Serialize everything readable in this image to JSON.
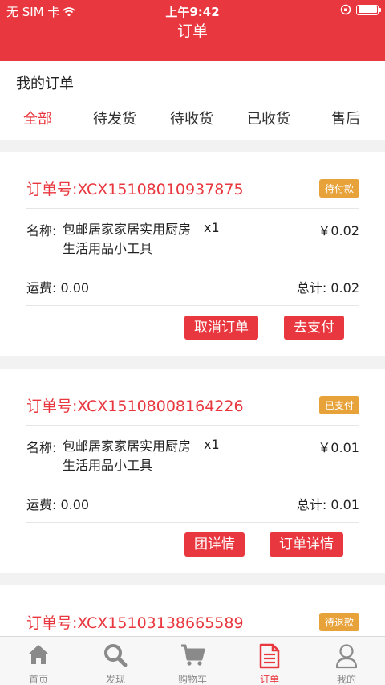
{
  "status_bar": {
    "carrier": "无 SIM 卡",
    "time": "上午9:42"
  },
  "nav": {
    "title": "订单"
  },
  "section_title": "我的订单",
  "tabs": [
    {
      "label": "全部",
      "active": true
    },
    {
      "label": "待发货",
      "active": false
    },
    {
      "label": "待收货",
      "active": false
    },
    {
      "label": "已收货",
      "active": false
    },
    {
      "label": "售后",
      "active": false
    }
  ],
  "orders": [
    {
      "order_no": "订单号:XCX15108010937875",
      "status": "待付款",
      "name_label": "名称:",
      "product_name": "包邮居家家居实用厨房生活用品小工具",
      "qty": "x1",
      "price": "￥0.02",
      "freight": "运费: 0.00",
      "total": "总计: 0.02",
      "buttons": [
        "取消订单",
        "去支付"
      ]
    },
    {
      "order_no": "订单号:XCX15108008164226",
      "status": "已支付",
      "name_label": "名称:",
      "product_name": "包邮居家家居实用厨房生活用品小工具",
      "qty": "x1",
      "price": "￥0.01",
      "freight": "运费: 0.00",
      "total": "总计: 0.01",
      "buttons": [
        "团详情",
        "订单详情"
      ]
    },
    {
      "order_no": "订单号:XCX15103138665589",
      "status": "待退款"
    }
  ],
  "tabbar": [
    {
      "label": "首页",
      "icon": "home-icon",
      "active": false
    },
    {
      "label": "发现",
      "icon": "search-icon",
      "active": false
    },
    {
      "label": "购物车",
      "icon": "cart-icon",
      "active": false
    },
    {
      "label": "订单",
      "icon": "order-doc-icon",
      "active": true
    },
    {
      "label": "我的",
      "icon": "user-icon",
      "active": false
    }
  ],
  "colors": {
    "brand_red": "#e8373e",
    "badge_orange": "#e7a23a",
    "background": "#f2f2f2"
  }
}
